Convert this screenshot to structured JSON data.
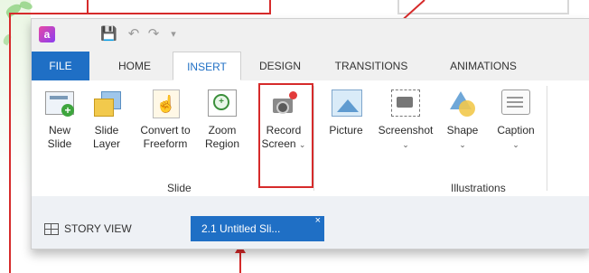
{
  "quick_access": {
    "save_icon": "save-icon",
    "undo_icon": "undo-icon",
    "redo_icon": "redo-icon",
    "customize_icon": "customize-qat-icon"
  },
  "tabs": [
    {
      "label": "FILE"
    },
    {
      "label": "HOME"
    },
    {
      "label": "INSERT"
    },
    {
      "label": "DESIGN"
    },
    {
      "label": "TRANSITIONS"
    },
    {
      "label": "ANIMATIONS"
    }
  ],
  "active_tab": "INSERT",
  "ribbon": {
    "slide_group": {
      "label": "Slide",
      "tools": [
        {
          "label": "New\nSlide",
          "icon": "new-slide-icon"
        },
        {
          "label": "Slide\nLayer",
          "icon": "slide-layer-icon"
        },
        {
          "label": "Convert to\nFreeform",
          "icon": "convert-freeform-icon"
        },
        {
          "label": "Zoom\nRegion",
          "icon": "zoom-region-icon"
        },
        {
          "label": "Record\nScreen",
          "icon": "record-screen-icon",
          "dropdown": "⌄"
        }
      ]
    },
    "illustrations_group": {
      "label": "Illustrations",
      "tools": [
        {
          "label": "Picture",
          "icon": "picture-icon"
        },
        {
          "label": "Screenshot",
          "icon": "screenshot-icon",
          "dropdown": "⌄"
        },
        {
          "label": "Shape",
          "icon": "shape-icon",
          "dropdown": "⌄"
        },
        {
          "label": "Caption",
          "icon": "caption-icon",
          "dropdown": "⌄"
        }
      ]
    }
  },
  "doc_tabs": {
    "story_view": "STORY VIEW",
    "slide_tab": "2.1 Untitled Sli...",
    "close": "×"
  },
  "colors": {
    "accent": "#1f6fc5",
    "annotation": "#d62b2b"
  }
}
